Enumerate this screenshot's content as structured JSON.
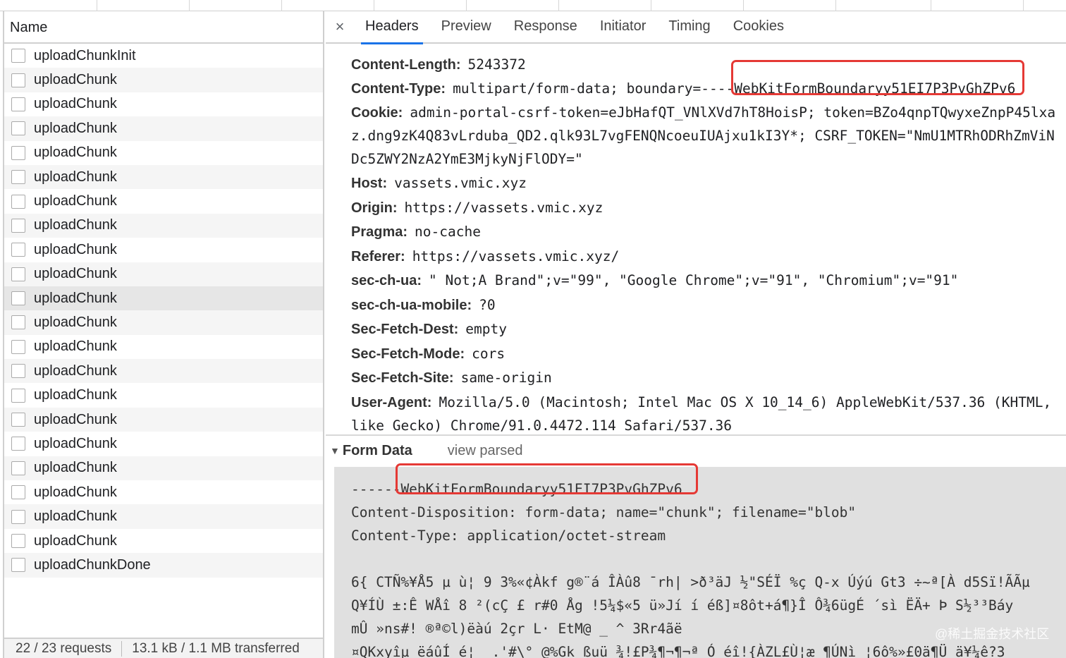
{
  "name_header": "Name",
  "requests": [
    "uploadChunkInit",
    "uploadChunk",
    "uploadChunk",
    "uploadChunk",
    "uploadChunk",
    "uploadChunk",
    "uploadChunk",
    "uploadChunk",
    "uploadChunk",
    "uploadChunk",
    "uploadChunk",
    "uploadChunk",
    "uploadChunk",
    "uploadChunk",
    "uploadChunk",
    "uploadChunk",
    "uploadChunk",
    "uploadChunk",
    "uploadChunk",
    "uploadChunk",
    "uploadChunk",
    "uploadChunkDone"
  ],
  "selected_index": 10,
  "status": {
    "requests": "22 / 23 requests",
    "transferred": "13.1 kB / 1.1 MB transferred"
  },
  "tabs": [
    "Headers",
    "Preview",
    "Response",
    "Initiator",
    "Timing",
    "Cookies"
  ],
  "active_tab": "Headers",
  "close_icon": "×",
  "headers": {
    "content_length": {
      "k": "Content-Length:",
      "v": "5243372"
    },
    "content_type": {
      "k": "Content-Type:",
      "v": "multipart/form-data; boundary=----WebKitFormBoundaryy51EI7P3PvGhZPv6"
    },
    "cookie": {
      "k": "Cookie:",
      "v": "admin-portal-csrf-token=eJbHafQT_VNlXVd7hT8HoisP; token=BZo4qnpTQwyxeZnpP45lxa"
    },
    "cookie_cont1": "z.dng9zK4Q83vLrduba_QD2.qlk93L7vgFENQNcoeuIUAjxu1kI3Y*; CSRF_TOKEN=\"NmU1MTRhODRhZmViN",
    "cookie_cont2": "Dc5ZWY2NzA2YmE3MjkyNjFlODY=\"",
    "host": {
      "k": "Host:",
      "v": "vassets.vmic.xyz"
    },
    "origin": {
      "k": "Origin:",
      "v": "https://vassets.vmic.xyz"
    },
    "pragma": {
      "k": "Pragma:",
      "v": "no-cache"
    },
    "referer": {
      "k": "Referer:",
      "v": "https://vassets.vmic.xyz/"
    },
    "sec_ch_ua": {
      "k": "sec-ch-ua:",
      "v": "\" Not;A Brand\";v=\"99\", \"Google Chrome\";v=\"91\", \"Chromium\";v=\"91\""
    },
    "sec_ch_ua_mobile": {
      "k": "sec-ch-ua-mobile:",
      "v": "?0"
    },
    "sec_fetch_dest": {
      "k": "Sec-Fetch-Dest:",
      "v": "empty"
    },
    "sec_fetch_mode": {
      "k": "Sec-Fetch-Mode:",
      "v": "cors"
    },
    "sec_fetch_site": {
      "k": "Sec-Fetch-Site:",
      "v": "same-origin"
    },
    "user_agent": {
      "k": "User-Agent:",
      "v": "Mozilla/5.0 (Macintosh; Intel Mac OS X 10_14_6) AppleWebKit/537.36 (KHTML,"
    },
    "user_agent_cont": "like Gecko) Chrome/91.0.4472.114 Safari/537.36"
  },
  "form_data": {
    "title": "Form Data",
    "view_parsed": "view parsed",
    "lines": [
      "------WebKitFormBoundaryy51EI7P3PvGhZPv6",
      "Content-Disposition: form-data; name=\"chunk\"; filename=\"blob\"",
      "Content-Type: application/octet-stream",
      "",
      "6{  CTÑ%¥Å5  µ ù¦  9 3%«¢Àkf  g®¨á ÎÀû8 ¯rh|  >ð³äJ ½\"SÉÏ %ç Q-x Úýú  Gt3 ÷~ª[À  d5Sï!ÃÃµ",
      "Q¥ÍÙ  ±:Ê WÅî  8   ²(cÇ  £ r#0 Åg !5¼$«5  ü»Jí  í  éß]¤8ôt+á¶}Î  Ô¾6ügÉ ´sì ËÄ+  Þ  S½³³Báy",
      "mÛ »ns#!   ®ª©l)ëàú  2çr  L·   EtM@  _   ^ 3Rr4ãë",
      "¤QKxyîµ ëáûÍ_é¦  _.'#\\°  @%Gk ßuü ¾!£P¾¶¬¶¬ª  Ó  éî!{ÀZL£Ù¦æ  ¶ÚNì  ¦6ô%»£0ä¶Ü ä¥¼ê?3"
    ]
  },
  "watermark": "@稀土掘金技术社区",
  "colors": {
    "accent": "#1a73e8",
    "highlight": "#e53935"
  }
}
